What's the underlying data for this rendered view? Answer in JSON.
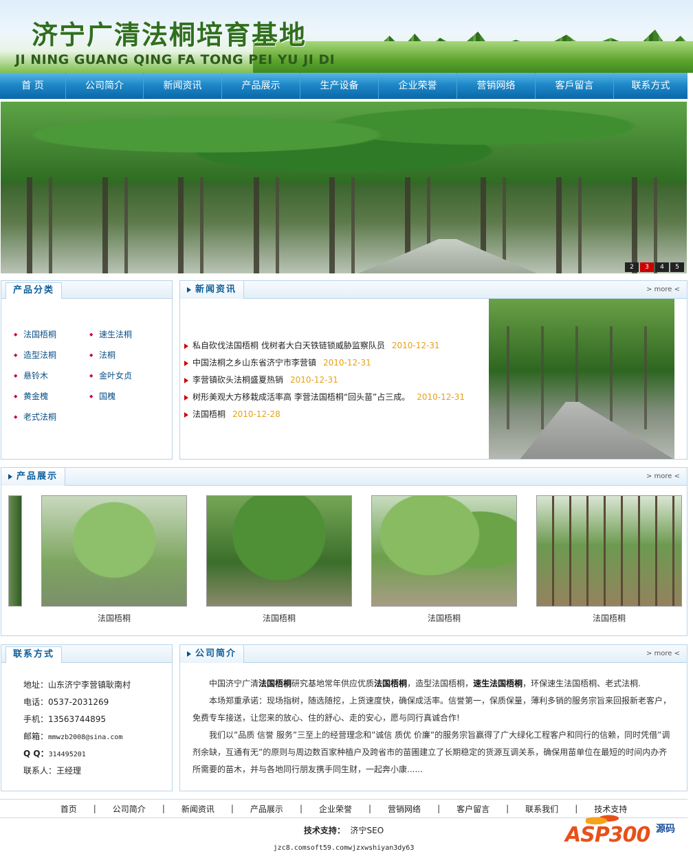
{
  "header": {
    "title_cn": "济宁广清法桐培育基地",
    "title_en": "JI NING GUANG QING  FA TONG PEI YU JI DI"
  },
  "nav": {
    "items": [
      "首  页",
      "公司简介",
      "新闻资讯",
      "产品展示",
      "生产设备",
      "企业荣誉",
      "营销网络",
      "客戶留言",
      "联系方式"
    ]
  },
  "banner": {
    "pager": [
      "2",
      "3",
      "4",
      "5"
    ],
    "active_page": "3"
  },
  "category": {
    "title": "产品分类",
    "items": [
      "法国梧桐",
      "速生法桐",
      "造型法桐",
      "法桐",
      "悬铃木",
      "金叶女贞",
      "黄金槐",
      "国槐",
      "老式法桐"
    ]
  },
  "news": {
    "title": "新闻资讯",
    "more": "> more <",
    "items": [
      {
        "text": "私自砍伐法国梧桐 伐树者大白天铁链锁威胁监察队员",
        "date": "2010-12-31"
      },
      {
        "text": "中国法桐之乡山东省济宁市李营镇",
        "date": "2010-12-31"
      },
      {
        "text": "李营镇砍头法桐盛夏热销",
        "date": "2010-12-31"
      },
      {
        "text": "树形美观大方移栽成活率高 李营法国梧桐“回头苗”占三成。",
        "date": "2010-12-31"
      },
      {
        "text": "法国梧桐",
        "date": "2010-12-28"
      }
    ]
  },
  "products": {
    "title": "产品展示",
    "more": "> more <",
    "items": [
      {
        "caption": "法国梧桐"
      },
      {
        "caption": "法国梧桐"
      },
      {
        "caption": "法国梧桐"
      },
      {
        "caption": "法国梧桐"
      }
    ]
  },
  "contact": {
    "title": "联系方式",
    "address": "地址：山东济宁李营镇耿南村",
    "phone": "电话：0537-2031269",
    "mobile": "手机：13563744895",
    "email_label": "邮箱：",
    "email": "mmwzb2008@sina.com",
    "qq_label": "Q Q：",
    "qq": "314495201",
    "person": "联系人：王经理"
  },
  "intro": {
    "title": "公司简介",
    "more": "> more <",
    "p1_a": "中国济宁广清",
    "p1_b": "法国梧桐",
    "p1_c": "研究基地常年供应优质",
    "p1_d": "法国梧桐",
    "p1_e": "，造型法国梧桐，",
    "p1_f": "速生法国梧桐",
    "p1_g": "，环保速生法国梧桐、老式法桐.",
    "p2": "本场郑重承诺：现场指树，随选随挖，上货速度快，确保成活率。信誉第一，保质保量，薄利多销的服务宗旨来回报新老客户，免费专车接送，让您来的放心、住的舒心、走的安心，愿与同行真诚合作!",
    "p3": "我们以”品质  信誉  服务”三至上的经营理念和”诚信  质优  价廉”的服务宗旨赢得了广大绿化工程客户和同行的信赖，同时凭借”调剂余缺，互通有无”的原则与周边数百家种植户及跨省市的苗圃建立了长期稳定的货源互调关系，确保用苗单位在最短的时间内办齐所需要的苗木，并与各地同行朋友携手同生财，一起奔小康......"
  },
  "footer": {
    "nav": [
      "首页",
      "公司简介",
      "新闻资讯",
      "产品展示",
      "企业荣誉",
      "营销网络",
      "客户留言",
      "联系我们",
      "技术支持"
    ],
    "tech_label": "技术支持：",
    "tech_value": "济宁SEO",
    "url": "jzc8.comsoft59.comwjzxwshiyan3dy63",
    "logo_text": "ASP300",
    "logo_suffix": "源码"
  }
}
